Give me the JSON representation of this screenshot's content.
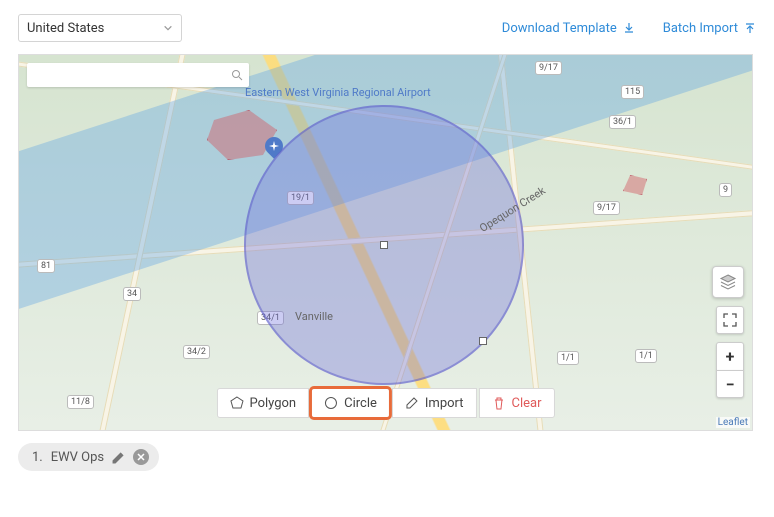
{
  "topbar": {
    "country_select_value": "United States",
    "download_template": "Download Template",
    "batch_import": "Batch Import"
  },
  "search": {
    "placeholder": ""
  },
  "map": {
    "airport_label": "Eastern West\nVirginia Regional\nAirport",
    "town1": "Vanville",
    "town2": "Opequon Creek",
    "shields": [
      "9/17",
      "9/17",
      "36/1",
      "115",
      "19/1",
      "34/1",
      "34/2",
      "34",
      "11/8",
      "9",
      "1/1",
      "1/1",
      "81"
    ],
    "attribution": "Leaflet"
  },
  "toolbar": {
    "polygon": "Polygon",
    "circle": "Circle",
    "import": "Import",
    "clear": "Clear"
  },
  "controls": {
    "zoom_in": "+",
    "zoom_out": "−"
  },
  "zones": [
    {
      "index": "1.",
      "name": "EWV Ops"
    }
  ]
}
